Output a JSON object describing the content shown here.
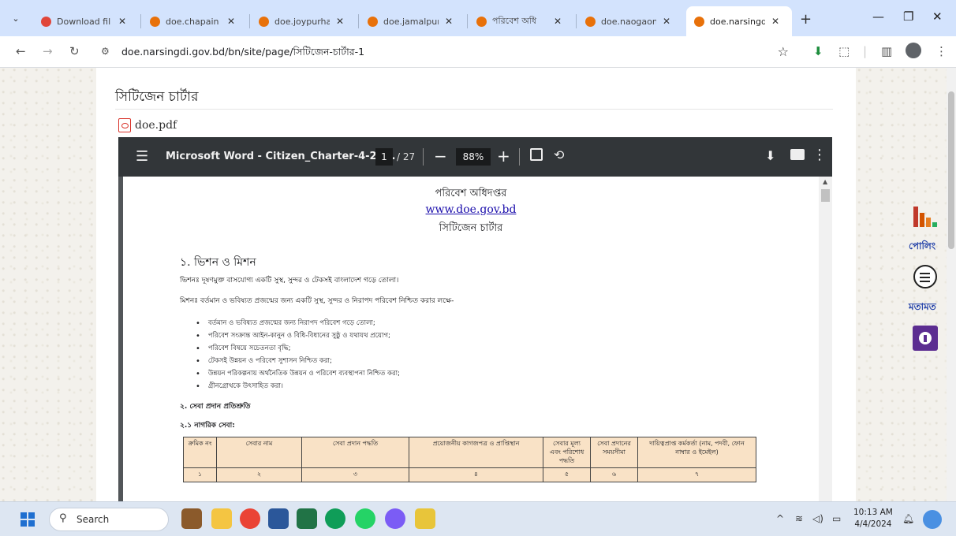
{
  "browser": {
    "tabs": [
      {
        "title": "Download fil",
        "active": false
      },
      {
        "title": "doe.chapain",
        "active": false
      },
      {
        "title": "doe.joypurha",
        "active": false
      },
      {
        "title": "doe.jamalpur",
        "active": false
      },
      {
        "title": "পরিবেশ অধি",
        "active": false
      },
      {
        "title": "doe.naogaon",
        "active": false
      },
      {
        "title": "doe.narsingd",
        "active": true
      }
    ],
    "new_tab_label": "+",
    "window": {
      "minimize": "—",
      "restore": "❐",
      "close": "✕"
    },
    "url": "doe.narsingdi.gov.bd/bn/site/page/সিটিজেন-চার্টার-1"
  },
  "page": {
    "heading": "সিটিজেন চার্টার",
    "file_name": "doe.pdf"
  },
  "pdf_viewer": {
    "title": "Microsoft Word - Citizen_Charter-4-20...",
    "current_page": "1",
    "total_pages": "/ 27",
    "zoom": "88%"
  },
  "document": {
    "org": "পরিবেশ অধিদপ্তর",
    "website": "www.doe.gov.bd",
    "subtitle": "সিটিজেন চার্টার",
    "section1_title": "১. ভিশন ও মিশন",
    "vision": "ভিশনঃ দূষণমুক্ত বাসযোগ্য একটি সুস্থ, সুন্দর ও টেকসই বাংলাদেশ গড়ে তোলা।",
    "mission": "মিশনঃ বর্তমান ও ভবিষ্যত প্রজন্মের জন্য একটি সুস্থ, সুন্দর ও নিরাপদ পরিবেশ নিশ্চিত করার লক্ষে-",
    "bullets": [
      "বর্তমান ও ভবিষ্যত প্রজন্মের জন্য নিরাপদ পরিবেশ গড়ে তোলা;",
      "পরিবেশ সংক্রান্ত আইন-কানুন ও বিধি-বিধানের সুষ্ঠু ও যথাযথ প্রয়োগ;",
      "পরিবেশ বিষয়ে সচেতনতা বৃদ্ধি;",
      "টেকসই উন্নয়ন ও পরিবেশ সুশাসন নিশ্চিত করা;",
      "উন্নয়ন পরিকল্পনায় অর্থনৈতিক উন্নয়ন ও পরিবেশ ব্যবস্থাপনা নিশ্চিত করা;",
      "গ্রীনগ্রোথকে উৎসাহিত করা।"
    ],
    "section2_title": "২. সেবা প্রদান প্রতিশ্রুতি",
    "section21_title": "২.১ নাগরিক সেবা:",
    "table_headers": [
      "ক্রমিক নং",
      "সেবার নাম",
      "সেবা প্রদান পদ্ধতি",
      "প্রয়োজনীয় কাগজপত্র ও প্রাপ্তিস্থান",
      "সেবার মূল্য এবং পরিশোধ পদ্ধতি",
      "সেবা প্রদানের সময়সীমা",
      "দায়িত্বপ্রাপ্ত কর্মকর্তা (নাম, পদবী, ফোন নাম্বার ও ইমেইল)"
    ],
    "table_numbers": [
      "১",
      "২",
      "৩",
      "৪",
      "৫",
      "৬",
      "৭"
    ]
  },
  "sidebar_widgets": {
    "poll_label": "পোলিং",
    "feedback_label": "মতামত"
  },
  "taskbar": {
    "search_placeholder": "Search",
    "time": "10:13 AM",
    "date": "4/4/2024"
  }
}
